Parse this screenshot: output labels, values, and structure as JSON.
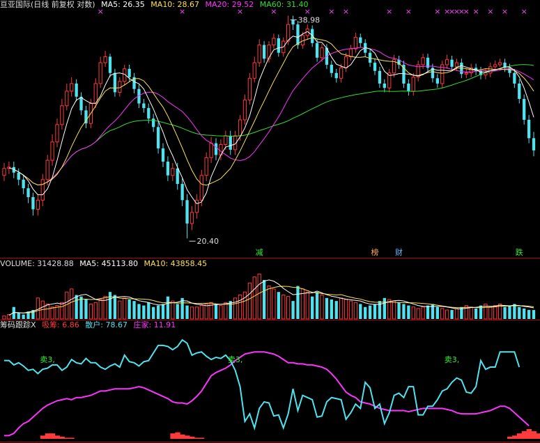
{
  "colors": {
    "up": "#ff3a3a",
    "down": "#4fe3f0",
    "ma5": "#ffffff",
    "ma10": "#ffe34d",
    "ma20": "#ff33ff",
    "ma60": "#33dd33",
    "divider": "#b00000",
    "text_label": "#dddddd",
    "marker": "#ff44ff",
    "signal_green": "#33ee33",
    "xichou": "#ff3a3a",
    "sanhu": "#4fe3f0",
    "zhuangjia": "#ff33ff"
  },
  "price_panel": {
    "title": "亘亚国际(日线 前复权 对数)",
    "ma5_label": "MA5: 26.35",
    "ma10_label": "MA10: 28.67",
    "ma20_label": "MA20: 29.52",
    "ma60_label": "MA60: 31.40",
    "high_label": "38.98",
    "low_label": "20.40",
    "event_labels": [
      {
        "text": "减",
        "index": 53,
        "color": "#33ee33"
      },
      {
        "text": "榜",
        "index": 77,
        "color": "#ffaa55"
      },
      {
        "text": "财",
        "index": 82,
        "color": "#66bbff"
      },
      {
        "text": "跌",
        "index": 107,
        "color": "#33ee33"
      }
    ],
    "top_marker": "×",
    "top_markers": [
      20,
      37,
      49,
      56,
      63,
      68,
      71,
      80,
      84,
      90,
      92,
      93,
      94,
      95,
      96,
      98,
      101,
      104,
      108
    ]
  },
  "volume_panel": {
    "volume_label": "VOLUME: 31428.88",
    "ma5_label": "MA5: 45113.80",
    "ma10_label": "MA10: 43858.45"
  },
  "indicator_panel": {
    "name_label": "筹码跟踪X",
    "xichou_label": "吸筹: 6.86",
    "sanhu_label": "散户: 78.67",
    "zhuangjia_label": "庄家: 11.91",
    "sell_label": "卖3,",
    "sell_points": [
      9,
      48,
      93
    ]
  },
  "chart_data": {
    "type": "candlestick",
    "price_range": [
      20,
      39.5
    ],
    "log_scale": true,
    "grid": false,
    "series": [
      {
        "name": "MA5"
      },
      {
        "name": "MA10"
      },
      {
        "name": "MA20"
      },
      {
        "name": "MA60"
      },
      {
        "name": "VOLUME"
      },
      {
        "name": "吸筹"
      },
      {
        "name": "散户"
      },
      {
        "name": "庄家"
      }
    ],
    "close": [
      25.0,
      25.1,
      24.7,
      24.2,
      23.6,
      23.0,
      22.2,
      22.8,
      24.2,
      25.6,
      27.0,
      28.4,
      30.0,
      31.3,
      32.0,
      30.8,
      29.6,
      28.5,
      30.2,
      32.0,
      34.0,
      34.6,
      33.0,
      31.2,
      32.2,
      33.4,
      32.6,
      31.5,
      30.2,
      29.8,
      28.9,
      28.2,
      26.5,
      25.5,
      24.5,
      25.0,
      23.9,
      22.8,
      21.3,
      22.0,
      22.8,
      24.5,
      25.8,
      26.9,
      26.0,
      26.8,
      27.5,
      26.4,
      27.5,
      28.8,
      30.5,
      32.5,
      34.0,
      35.8,
      34.4,
      35.8,
      36.5,
      35.0,
      36.2,
      38.0,
      38.0,
      35.8,
      36.8,
      37.5,
      36.0,
      34.5,
      35.5,
      33.8,
      33.0,
      32.5,
      33.5,
      34.6,
      35.4,
      36.6,
      36.0,
      35.0,
      34.0,
      33.2,
      32.0,
      31.6,
      33.0,
      34.3,
      33.8,
      32.0,
      31.3,
      32.6,
      33.8,
      34.5,
      33.5,
      32.5,
      32.0,
      33.8,
      34.3,
      33.6,
      34.0,
      32.9,
      33.0,
      33.5,
      33.2,
      32.8,
      33.0,
      33.6,
      33.8,
      34.0,
      33.5,
      33.0,
      32.0,
      30.6,
      28.8,
      27.3,
      26.35
    ],
    "open": [
      24.5,
      25.0,
      25.1,
      24.7,
      24.2,
      23.6,
      23.0,
      22.2,
      22.8,
      24.2,
      25.6,
      27.0,
      28.4,
      30.0,
      31.3,
      32.0,
      30.8,
      29.6,
      28.5,
      30.2,
      32.0,
      34.0,
      34.6,
      33.0,
      31.2,
      32.2,
      33.4,
      32.6,
      31.5,
      30.2,
      29.8,
      28.9,
      28.2,
      26.5,
      25.5,
      24.5,
      25.0,
      23.9,
      22.8,
      21.3,
      22.0,
      22.8,
      24.5,
      25.8,
      26.9,
      26.0,
      26.8,
      27.5,
      26.4,
      27.5,
      28.8,
      30.5,
      32.5,
      34.0,
      35.8,
      34.4,
      35.8,
      36.5,
      35.0,
      36.2,
      38.5,
      38.0,
      35.8,
      36.8,
      37.5,
      36.0,
      34.5,
      35.5,
      33.8,
      33.0,
      32.5,
      33.5,
      34.6,
      35.4,
      36.6,
      36.0,
      35.0,
      34.0,
      33.2,
      32.0,
      31.6,
      33.0,
      34.3,
      33.8,
      32.0,
      31.3,
      32.6,
      33.8,
      34.5,
      33.5,
      32.5,
      32.0,
      33.8,
      34.3,
      33.6,
      34.0,
      32.9,
      33.0,
      33.5,
      33.2,
      32.8,
      33.0,
      33.6,
      33.8,
      34.0,
      33.5,
      33.0,
      32.0,
      30.6,
      28.8,
      27.3
    ],
    "high": [
      25.4,
      25.5,
      25.5,
      25.0,
      24.5,
      23.9,
      23.3,
      23.2,
      24.6,
      26.0,
      27.6,
      28.9,
      30.6,
      32.0,
      32.6,
      32.4,
      31.2,
      30.0,
      30.6,
      32.5,
      34.6,
      35.2,
      34.9,
      33.4,
      32.6,
      33.8,
      33.8,
      33.0,
      31.9,
      30.6,
      30.2,
      29.3,
      28.6,
      26.9,
      25.9,
      25.4,
      25.4,
      24.3,
      23.2,
      22.4,
      23.2,
      24.9,
      26.2,
      27.4,
      27.3,
      27.2,
      27.9,
      27.9,
      27.9,
      29.2,
      31.0,
      33.0,
      34.6,
      36.4,
      36.2,
      36.2,
      37.0,
      36.9,
      36.6,
      38.98,
      38.98,
      38.4,
      37.2,
      38.0,
      37.9,
      36.4,
      35.9,
      35.9,
      34.2,
      33.4,
      33.9,
      35.0,
      35.8,
      37.1,
      37.0,
      36.4,
      35.4,
      34.4,
      33.6,
      32.4,
      33.4,
      34.8,
      34.7,
      34.2,
      32.4,
      33.0,
      34.2,
      34.9,
      34.9,
      33.9,
      32.9,
      34.2,
      34.8,
      34.7,
      34.4,
      34.4,
      33.4,
      33.9,
      33.9,
      33.6,
      33.4,
      34.0,
      34.2,
      34.4,
      34.4,
      33.9,
      33.4,
      32.4,
      31.0,
      29.2,
      27.8
    ],
    "low": [
      24.1,
      24.6,
      24.3,
      23.8,
      23.2,
      22.6,
      21.8,
      21.8,
      22.4,
      23.8,
      25.2,
      26.6,
      28.0,
      29.6,
      30.8,
      30.4,
      29.2,
      28.1,
      28.1,
      29.8,
      31.6,
      33.6,
      32.6,
      30.8,
      30.8,
      31.8,
      32.2,
      31.1,
      29.8,
      29.4,
      28.5,
      27.8,
      26.1,
      25.1,
      24.1,
      24.1,
      23.5,
      22.4,
      20.4,
      20.9,
      21.6,
      22.4,
      24.1,
      25.4,
      25.6,
      25.6,
      26.4,
      26.0,
      26.0,
      27.1,
      28.4,
      30.1,
      32.1,
      33.6,
      34.0,
      34.0,
      35.4,
      34.6,
      34.6,
      35.8,
      37.4,
      35.4,
      35.4,
      36.4,
      35.6,
      34.1,
      34.1,
      33.4,
      32.6,
      32.1,
      32.1,
      33.1,
      34.2,
      35.0,
      35.6,
      34.6,
      33.6,
      32.8,
      31.6,
      31.2,
      31.2,
      32.6,
      33.4,
      31.6,
      30.9,
      30.9,
      32.2,
      33.4,
      33.1,
      32.1,
      31.6,
      31.6,
      33.4,
      33.2,
      33.2,
      32.5,
      32.5,
      32.6,
      32.8,
      32.4,
      32.4,
      32.6,
      33.4,
      33.6,
      33.1,
      32.6,
      31.6,
      30.2,
      28.4,
      26.9,
      25.9
    ],
    "volume": [
      2,
      3,
      8,
      4,
      3,
      5,
      6,
      14,
      12,
      10,
      8,
      9,
      11,
      18,
      20,
      16,
      15,
      13,
      10,
      11,
      13,
      15,
      18,
      16,
      12,
      14,
      13,
      12,
      10,
      9,
      11,
      8,
      9,
      10,
      15,
      12,
      10,
      14,
      9,
      8,
      8,
      9,
      10,
      11,
      10,
      9,
      11,
      12,
      14,
      16,
      18,
      24,
      28,
      30,
      26,
      22,
      20,
      18,
      16,
      15,
      12,
      22,
      20,
      18,
      15,
      18,
      16,
      14,
      13,
      12,
      14,
      13,
      12,
      11,
      10,
      8,
      9,
      10,
      12,
      14,
      13,
      12,
      11,
      10,
      9,
      8,
      7,
      8,
      9,
      10,
      8,
      7,
      6,
      6,
      7,
      8,
      9,
      8,
      7,
      9,
      10,
      8,
      9,
      10,
      8,
      9,
      10,
      8,
      7,
      6,
      6
    ],
    "ma5": [],
    "ma10": [],
    "ma20": [],
    "ma60": [],
    "xichou": [
      0,
      0,
      0,
      0,
      0,
      0,
      0,
      0,
      3,
      5,
      5,
      3,
      2,
      1,
      1,
      0,
      0,
      0,
      0,
      0,
      0,
      0,
      0,
      0,
      0,
      0,
      0,
      0,
      0,
      0,
      0,
      0,
      0,
      0,
      0,
      5,
      6,
      4,
      3,
      2,
      1,
      1,
      0,
      0,
      0,
      0,
      0,
      0,
      0,
      0,
      0,
      0,
      0,
      0,
      0,
      0,
      0,
      0,
      0,
      0,
      0,
      0,
      0,
      0,
      0,
      0,
      0,
      0,
      0,
      0,
      0,
      0,
      0,
      0,
      0,
      0,
      0,
      0,
      0,
      0,
      0,
      0,
      0,
      0,
      0,
      0,
      0,
      0,
      0,
      0,
      0,
      0,
      0,
      0,
      0,
      0,
      0,
      0,
      0,
      0,
      0,
      0,
      0,
      0,
      0,
      2,
      3,
      5,
      7,
      9,
      7,
      5,
      3
    ],
    "sanhu": [
      72,
      72,
      68,
      70,
      67,
      63,
      64,
      60,
      64,
      65,
      68,
      68,
      63,
      66,
      73,
      70,
      69,
      74,
      70,
      70,
      66,
      64,
      67,
      69,
      66,
      77,
      71,
      70,
      67,
      71,
      72,
      79,
      86,
      86,
      85,
      82,
      85,
      91,
      88,
      77,
      79,
      80,
      76,
      73,
      75,
      74,
      77,
      72,
      63,
      48,
      16,
      23,
      10,
      28,
      34,
      33,
      21,
      22,
      10,
      23,
      46,
      26,
      40,
      38,
      36,
      20,
      21,
      34,
      38,
      37,
      36,
      18,
      24,
      32,
      28,
      52,
      47,
      28,
      32,
      14,
      24,
      40,
      42,
      38,
      48,
      48,
      22,
      22,
      30,
      30,
      36,
      44,
      46,
      52,
      56,
      54,
      43,
      42,
      48,
      72,
      64,
      66,
      66,
      80,
      80,
      80,
      80,
      66
    ],
    "zhuangjia": [
      3,
      3,
      5,
      10,
      14,
      16,
      20,
      24,
      28,
      31,
      33,
      35,
      36,
      37,
      36,
      38,
      38,
      39,
      40,
      42,
      44,
      44,
      45,
      46,
      46,
      46,
      46,
      47,
      48,
      47,
      45,
      43,
      41,
      39,
      37,
      34,
      33,
      33,
      32,
      35,
      39,
      44,
      51,
      58,
      61,
      63,
      65,
      68,
      72,
      75,
      78,
      79,
      80,
      80,
      80,
      79,
      78,
      76,
      73,
      70,
      70,
      69,
      69,
      68,
      68,
      67,
      66,
      64,
      60,
      55,
      49,
      43,
      40,
      38,
      34,
      33,
      32,
      30,
      28,
      27,
      26,
      26,
      26,
      26,
      25,
      26,
      27,
      28,
      28,
      28,
      28,
      28,
      27,
      26,
      24,
      23,
      23,
      23,
      23,
      24,
      25,
      26,
      28,
      30,
      30,
      28,
      24,
      20,
      16,
      12
    ]
  }
}
